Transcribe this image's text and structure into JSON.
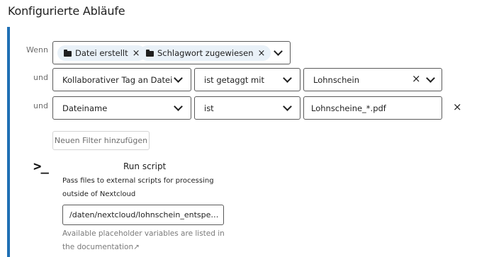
{
  "page": {
    "title": "Konfigurierte Abläufe"
  },
  "rules": {
    "wenn_label": "Wenn",
    "events": [
      {
        "label": "Datei erstellt",
        "icon": "folder-icon",
        "remove_icon": "×"
      },
      {
        "label": "Schlagwort zugewiesen",
        "icon": "folder-icon",
        "remove_icon": "×"
      }
    ],
    "checks": [
      {
        "connector": "und",
        "field": "Kollaborativer Tag an Datei",
        "operator": "ist getaggt mit",
        "value": "Lohnschein",
        "clear_icon": "×"
      },
      {
        "connector": "und",
        "field": "Dateiname",
        "operator": "ist",
        "value": "Lohnscheine_*.pdf",
        "remove_icon": "×"
      }
    ],
    "add_filter_label": "Neuen Filter hinzufügen"
  },
  "operation": {
    "icon_text": ">_",
    "title": "Run script",
    "description": "Pass files to external scripts for processing outside of Nextcloud",
    "script_value": "/daten/nextcloud/lohnschein_entsper ...",
    "hint": "Available placeholder variables are listed in the documentation↗"
  },
  "colors": {
    "accent": "#1f6fb4",
    "chip_bg": "#e9f1f8"
  }
}
